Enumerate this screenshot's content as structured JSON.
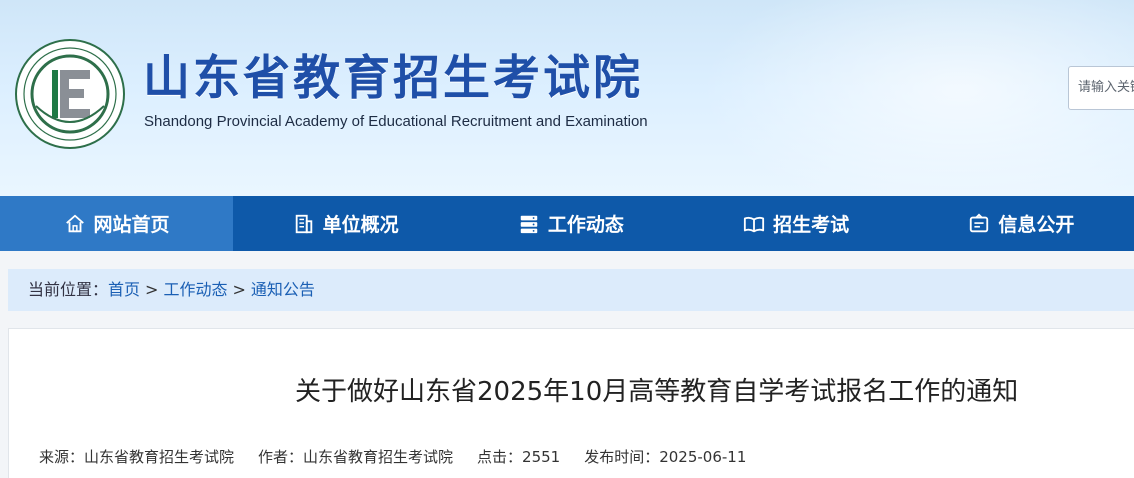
{
  "header": {
    "site_title": "山东省教育招生考试院",
    "site_subtitle": "Shandong Provincial Academy of Educational Recruitment and Examination",
    "search_placeholder": "请输入关键",
    "brand_color": "#1f4fa8"
  },
  "nav": {
    "items": [
      {
        "label": "网站首页",
        "icon": "home-icon",
        "active": true
      },
      {
        "label": "单位概况",
        "icon": "building-icon",
        "active": false
      },
      {
        "label": "工作动态",
        "icon": "server-icon",
        "active": false
      },
      {
        "label": "招生考试",
        "icon": "book-icon",
        "active": false
      },
      {
        "label": "信息公开",
        "icon": "info-board-icon",
        "active": false
      }
    ],
    "bg_color": "#0e59a9",
    "active_color": "#2f79c6"
  },
  "breadcrumb": {
    "prefix": "当前位置：",
    "items": [
      "首页",
      "工作动态",
      "通知公告"
    ],
    "separator": ">"
  },
  "article": {
    "title": "关于做好山东省2025年10月高等教育自学考试报名工作的通知",
    "meta": {
      "source": "来源：山东省教育招生考试院",
      "author": "作者：山东省教育招生考试院",
      "clicks": "点击：2551",
      "published": "发布时间：2025-06-11"
    }
  }
}
